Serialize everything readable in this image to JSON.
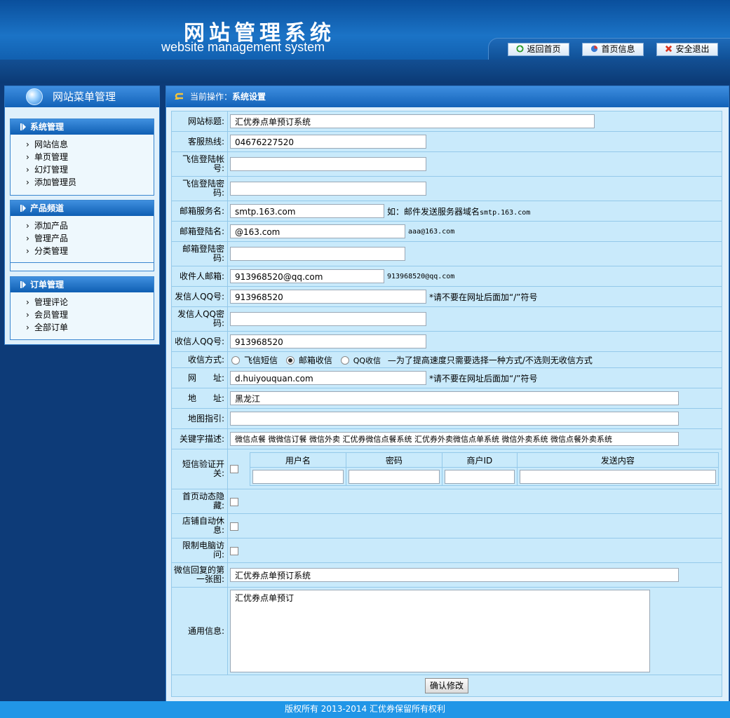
{
  "header": {
    "logo_cn": "网站管理系统",
    "logo_en": "website management system",
    "nav": [
      {
        "label": "返回首页",
        "icon": "refresh-icon"
      },
      {
        "label": "首页信息",
        "icon": "pie-chart-icon"
      },
      {
        "label": "安全退出",
        "icon": "close-icon"
      }
    ]
  },
  "sidebar": {
    "title": "网站菜单管理",
    "groups": [
      {
        "title": "系统管理",
        "items": [
          "网站信息",
          "单页管理",
          "幻灯管理",
          "添加管理员"
        ]
      },
      {
        "title": "产品频道",
        "items": [
          "添加产品",
          "管理产品",
          "分类管理"
        ]
      },
      {
        "title": "订单管理",
        "items": [
          "管理评论",
          "会员管理",
          "全部订单"
        ]
      }
    ]
  },
  "main": {
    "op_label": "当前操作：",
    "op_value": "系统设置",
    "fields": {
      "site_title": {
        "label": "网站标题:",
        "value": "汇优券点单预订系统"
      },
      "hotline": {
        "label": "客服热线:",
        "value": "04676227520"
      },
      "fetion_account": {
        "label": "飞信登陆帐号:",
        "value": ""
      },
      "fetion_password": {
        "label": "飞信登陆密码:",
        "value": ""
      },
      "mail_server": {
        "label": "邮箱服务名:",
        "value": "smtp.163.com",
        "note_prefix": "如：邮件发送服务器域名",
        "note_mono": "smtp.163.com"
      },
      "mail_login": {
        "label": "邮箱登陆名:",
        "value": "@163.com",
        "note_mono": "aaa@163.com"
      },
      "mail_password": {
        "label": "邮箱登陆密码:",
        "value": ""
      },
      "receiver_mail": {
        "label": "收件人邮箱:",
        "value": "913968520@qq.com",
        "note_mono": "913968520@qq.com"
      },
      "sender_qq": {
        "label": "发信人QQ号:",
        "value": "913968520",
        "note": "*请不要在网址后面加“/”符号"
      },
      "sender_qq_password": {
        "label": "发信人QQ密码:",
        "value": ""
      },
      "receiver_qq": {
        "label": "收信人QQ号:",
        "value": "913968520"
      },
      "receive_mode": {
        "label": "收信方式:",
        "options": [
          {
            "label": "飞信短信",
            "selected": false
          },
          {
            "label": "邮箱收信",
            "selected": true
          },
          {
            "label": "QQ收信",
            "selected": false
          }
        ],
        "note": "—为了提高速度只需要选择一种方式/不选则无收信方式"
      },
      "url": {
        "label": "网　　址:",
        "value": "d.huiyouquan.com",
        "note": "*请不要在网址后面加“/”符号"
      },
      "address": {
        "label": "地　　址:",
        "value": "黑龙江"
      },
      "map": {
        "label": "地图指引:",
        "value": ""
      },
      "keywords": {
        "label": "关键字描述:",
        "value": "微信点餐 微微信订餐 微信外卖 汇优券微信点餐系统 汇优券外卖微信点单系统 微信外卖系统 微信点餐外卖系统"
      },
      "sms_switch": {
        "label": "短信验证开关:",
        "checked": false,
        "columns": [
          "用户名",
          "密码",
          "商户ID",
          "发送内容"
        ],
        "values": [
          "",
          "",
          "",
          ""
        ]
      },
      "home_hide": {
        "label": "首页动态隐藏:",
        "checked": false
      },
      "shop_rest": {
        "label": "店铺自动休息:",
        "checked": false
      },
      "limit_pc": {
        "label": "限制电脑访问:",
        "checked": false
      },
      "wechat_first_image": {
        "label": "微信回复的第一张图:",
        "value": "汇优券点单预订系统"
      },
      "general_info": {
        "label": "通用信息:",
        "value": "汇优券点单预订"
      }
    },
    "submit_label": "确认修改"
  },
  "footer": {
    "text": "版权所有 2013-2014 汇优券保留所有权利"
  }
}
